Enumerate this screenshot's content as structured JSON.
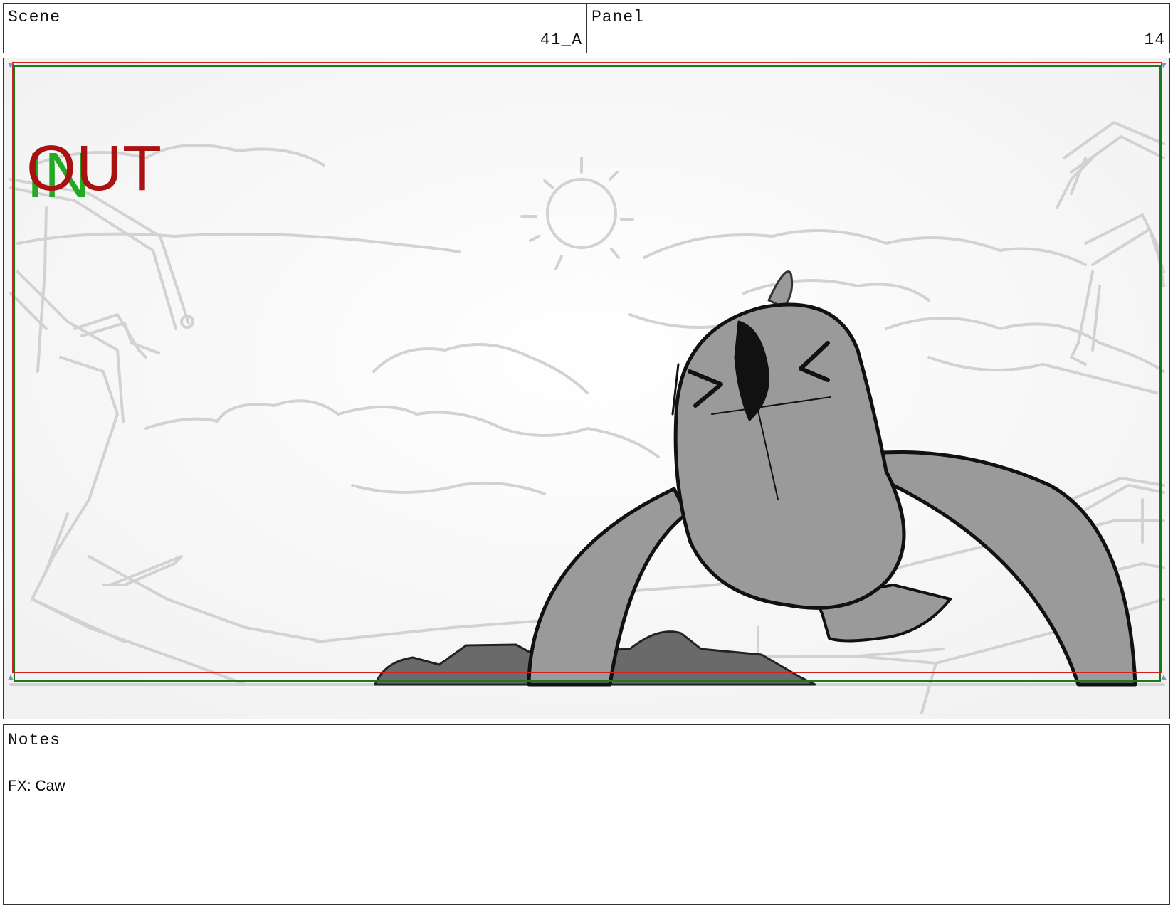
{
  "header": {
    "scene": {
      "label": "Scene",
      "value": "41_A"
    },
    "panel": {
      "label": "Panel",
      "value": "14"
    }
  },
  "frame": {
    "in_label": "IN",
    "out_label": "OUT",
    "colors": {
      "in": "#22aa22",
      "out": "#aa1111",
      "safe_green": "#1a7a1a",
      "safe_red": "#cc2222",
      "sketch": "#cfcfcf",
      "character_fill": "#9a9a9a",
      "rock_fill": "#6a6a6a"
    }
  },
  "notes": {
    "label": "Notes",
    "text": "FX: Caw"
  }
}
